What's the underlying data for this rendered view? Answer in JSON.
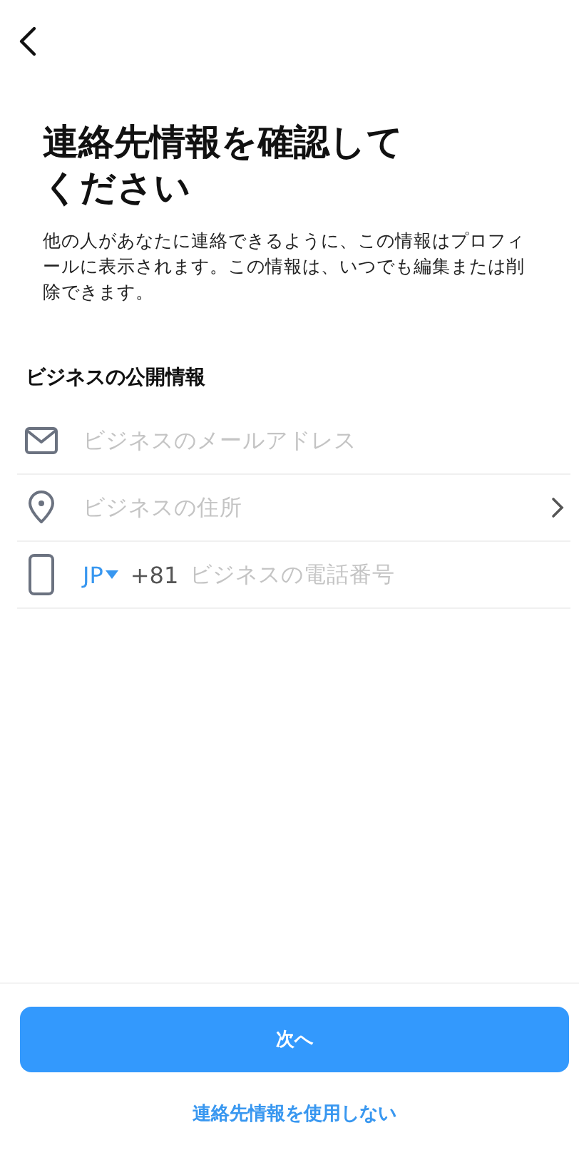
{
  "title": "連絡先情報を確認してください",
  "description": "他の人があなたに連絡できるように、この情報はプロフィールに表示されます。この情報は、いつでも編集または削除できます。",
  "section_label": "ビジネスの公開情報",
  "fields": [
    {
      "kind": "email",
      "placeholder": "ビジネスのメールアドレス"
    },
    {
      "kind": "address",
      "placeholder": "ビジネスの住所"
    },
    {
      "kind": "phone",
      "country": "JP",
      "dial_code": "+81",
      "placeholder": "ビジネスの電話番号"
    }
  ],
  "primary_button": "次へ",
  "secondary_link": "連絡先情報を使用しない"
}
